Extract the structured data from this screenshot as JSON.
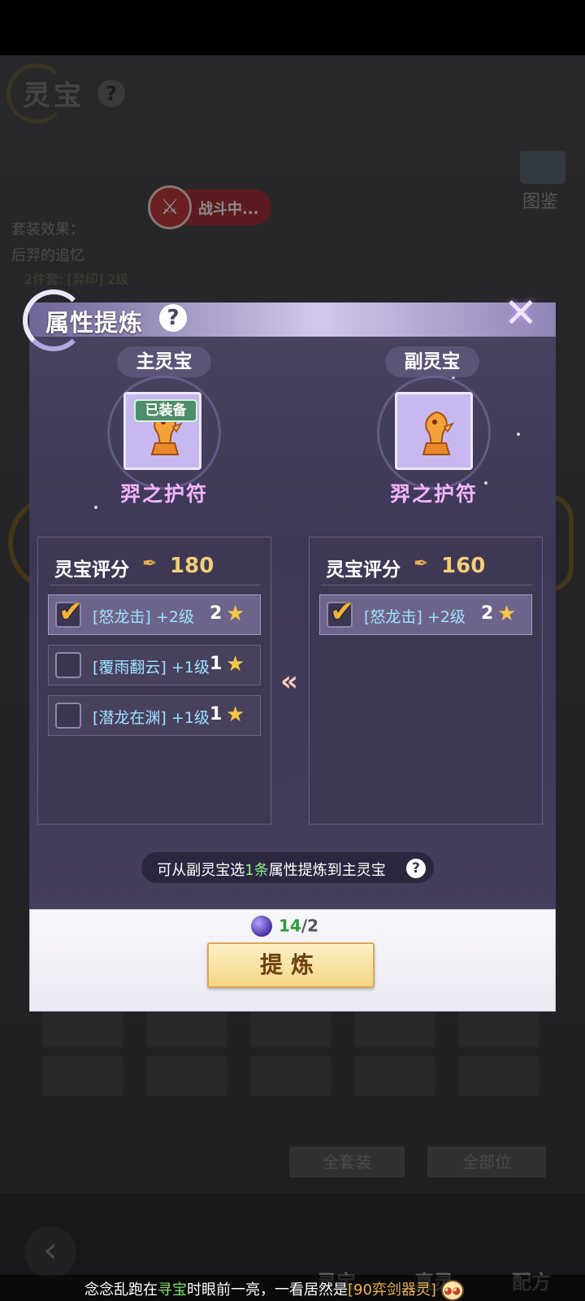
{
  "background": {
    "page_title": "灵宝",
    "help_glyph": "?",
    "codex_label": "图鉴",
    "battle_status": "战斗中...",
    "set_effects_label": "套装效果：",
    "set_name": "后羿的追忆",
    "set_line": "2件套: [羿印] 2级",
    "filter_all_sets": "全套装",
    "filter_all_slots": "全部位",
    "tabs": [
      {
        "label": "灵宝"
      },
      {
        "label": "真灵"
      },
      {
        "label": "配方"
      }
    ]
  },
  "modal": {
    "title": "属性提炼",
    "help_glyph": "?",
    "close_glyph": "✕",
    "main": {
      "label": "主灵宝",
      "item_name": "羿之护符",
      "equipped_badge": "已装备",
      "score_label": "灵宝评分",
      "score_value": "180",
      "attributes": [
        {
          "name": "[怒龙击] +2级",
          "level": "2",
          "checked": true
        },
        {
          "name": "[覆雨翻云] +1级",
          "level": "1",
          "checked": false
        },
        {
          "name": "[潜龙在渊] +1级",
          "level": "1",
          "checked": false
        }
      ]
    },
    "secondary": {
      "label": "副灵宝",
      "item_name": "羿之护符",
      "score_label": "灵宝评分",
      "score_value": "160",
      "attributes": [
        {
          "name": "[怒龙击] +2级",
          "level": "2",
          "checked": true
        }
      ]
    },
    "hint_pre": "可从副灵宝选",
    "hint_count": "1条",
    "hint_post": "属性提炼到主灵宝",
    "cost_have": "14",
    "cost_sep": "/",
    "cost_need": "2",
    "refine_label": "提炼"
  },
  "marquee": {
    "p1": "念念乱跑在",
    "p2": "寻宝",
    "p3": "时眼前一亮，一看居然是",
    "p4": "[90弈剑器灵]"
  },
  "colors": {
    "accent_gold": "#f2ce78",
    "attr_text": "#9fe1ff",
    "item_name": "#f3b4ff",
    "count_green": "#2f9c3b"
  }
}
